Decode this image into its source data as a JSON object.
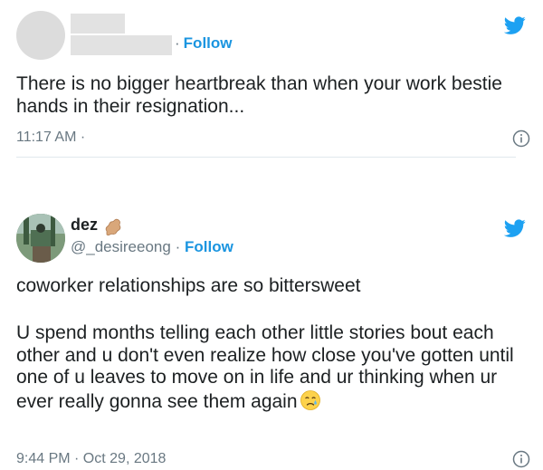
{
  "tweet1": {
    "follow_label": "Follow",
    "text": "There is no bigger heartbreak than when your work bestie hands in their resignation...",
    "time": "11:17 AM ·"
  },
  "tweet2": {
    "name": "dez",
    "handle": "@_desireeong",
    "separator": "·",
    "follow_label": "Follow",
    "text_line1": "coworker relationships are so bittersweet",
    "text_body": "U spend months telling each other little stories bout each other and u don't even realize how close you've gotten until one of u leaves to move on in life and ur thinking when ur ever really gonna see them again",
    "time": "9:44 PM · Oct 29, 2018"
  },
  "icons": {
    "brand": "twitter-bird-icon",
    "info": "info-icon",
    "name_emoji": "peanut-emoji",
    "text_emoji": "crying-face-emoji"
  },
  "colors": {
    "accent": "#1b95e0",
    "muted": "#697882",
    "text": "#1c2022",
    "border": "#e1e8ed"
  }
}
